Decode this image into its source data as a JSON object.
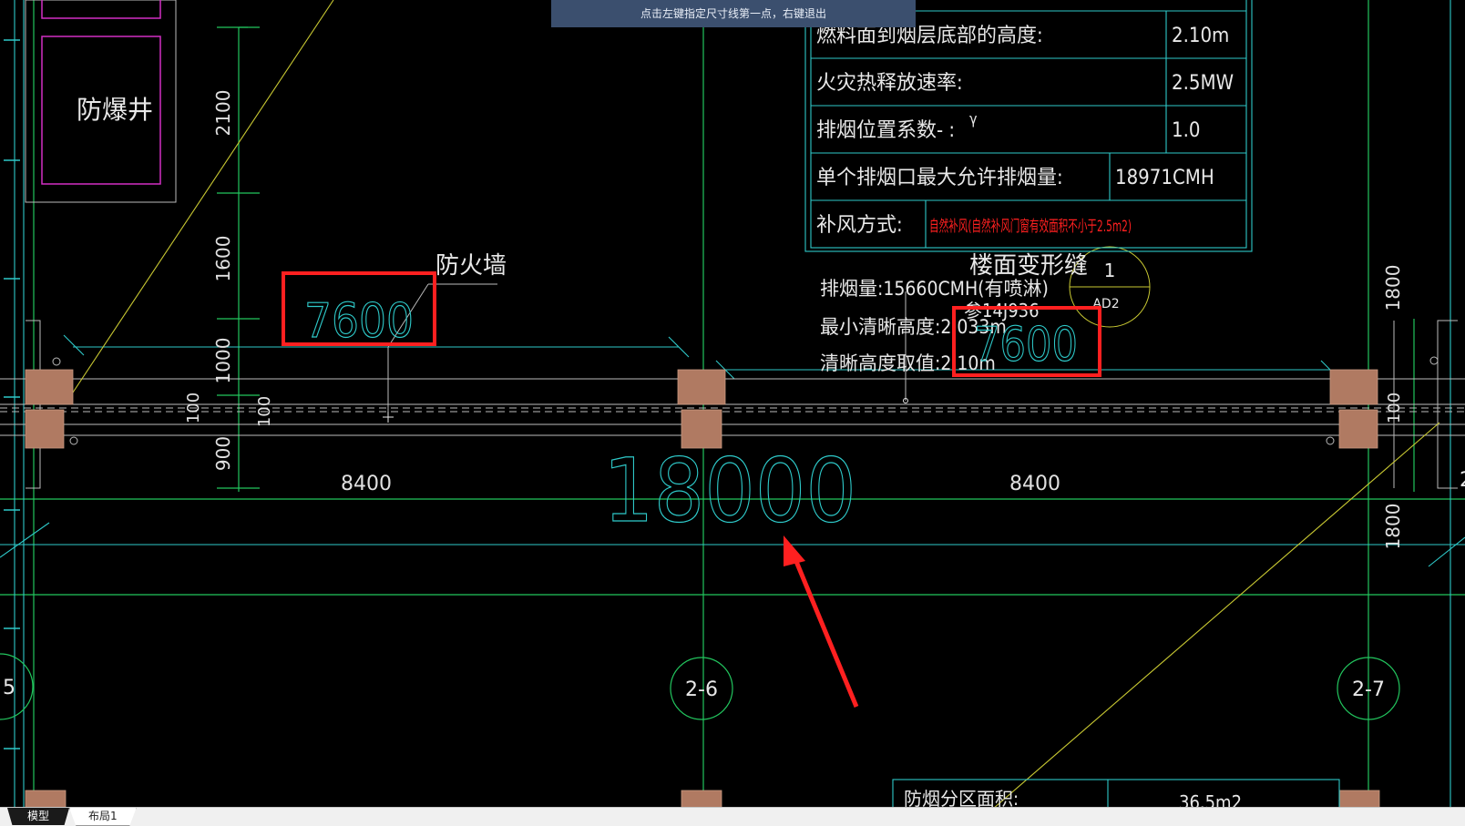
{
  "hint": "点击左键指定尺寸线第一点，右键退出",
  "tabs": {
    "model": "模型",
    "layout1": "布局1"
  },
  "labels": {
    "explosion_shaft": "防爆井",
    "firewall": "防火墙",
    "floor_joint": "楼面变形缝",
    "ref": "参14J936",
    "detail_top": "1",
    "detail_bottom": "AD2",
    "axis_a": "2-6",
    "axis_b": "2-7",
    "axis_left": "5",
    "edge_right": "2"
  },
  "smoke": {
    "volume": "排烟量:15660CMH(有喷淋)",
    "min_clear": "最小清晰高度:2.033m",
    "clear_value": "清晰高度取值:2.10m"
  },
  "table": {
    "rows": [
      {
        "label": "燃料面到烟层底部的高度:",
        "value": "2.10m"
      },
      {
        "label": "火灾热释放速率:",
        "value": "2.5MW"
      },
      {
        "label": "排烟位置系数- :",
        "mark": "γ",
        "value": "1.0"
      },
      {
        "label": "单个排烟口最大允许排烟量:",
        "value": "18971CMH"
      },
      {
        "label": "补风方式:",
        "value": "自然补风(自然补风门窗有效面积不小于2.5m2)"
      }
    ],
    "bottom_label": "防烟分区面积:",
    "bottom_value": "36.5m2"
  },
  "dims": {
    "boxed_left": "7600",
    "boxed_right": "7600",
    "big": "18000",
    "span_left": "8400",
    "span_right": "8400",
    "v_2100": "2100",
    "v_1600": "1600",
    "v_1000": "1000",
    "v_900": "900",
    "v_100a": "100",
    "v_100b": "100",
    "r_1800a": "1800",
    "r_100": "100",
    "r_1800b": "1800"
  },
  "colors": {
    "background": "#000000",
    "grid_green": "#22c55e",
    "dim_cyan": "#2ec9c9",
    "column_fill": "#b07a62",
    "highlight_red": "#ff2020",
    "magenta": "#d22fc4",
    "yellow_diag": "#c8c832",
    "hint_bg": "#3b4f6e"
  }
}
